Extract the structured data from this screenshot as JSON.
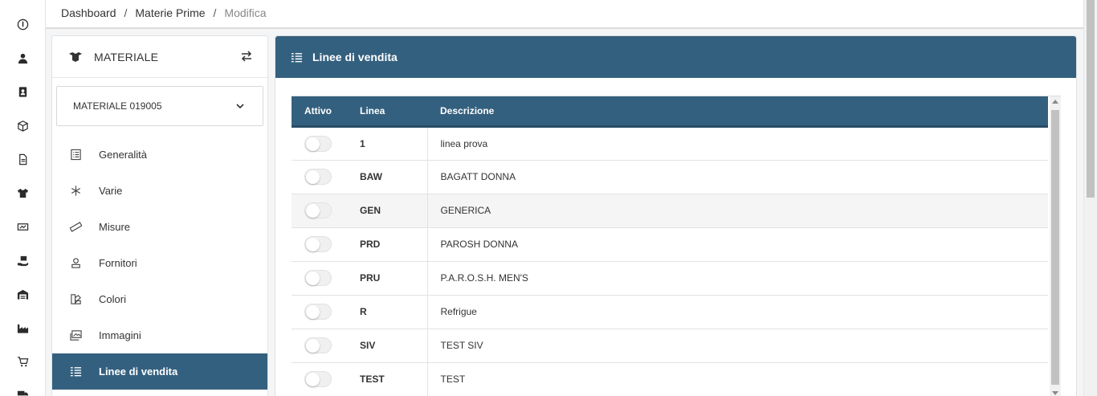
{
  "breadcrumb": {
    "items": [
      "Dashboard",
      "Materie Prime",
      "Modifica"
    ],
    "separator": "/"
  },
  "rail": {
    "icons": [
      "info-icon",
      "user-tie-icon",
      "address-book-icon",
      "box-open-icon",
      "file-icon",
      "tshirt-icon",
      "sign-icon",
      "box-hand-icon",
      "warehouse-icon",
      "industry-icon",
      "cart-icon",
      "truck-icon"
    ]
  },
  "material_card": {
    "title": "MATERIALE",
    "selected_material": "MATERIALE 019005",
    "menu": [
      {
        "label": "Generalità",
        "icon": "list-alt-icon"
      },
      {
        "label": "Varie",
        "icon": "asterisk-icon"
      },
      {
        "label": "Misure",
        "icon": "ruler-icon"
      },
      {
        "label": "Fornitori",
        "icon": "user-stamp-icon"
      },
      {
        "label": "Colori",
        "icon": "palette-icon"
      },
      {
        "label": "Immagini",
        "icon": "images-icon"
      },
      {
        "label": "Linee di vendita",
        "icon": "th-list-icon",
        "active": true
      }
    ]
  },
  "panel": {
    "title": "Linee di vendita",
    "columns": [
      "Attivo",
      "Linea",
      "Descrizione"
    ],
    "rows": [
      {
        "active": false,
        "code": "1",
        "description": "linea prova"
      },
      {
        "active": false,
        "code": "BAW",
        "description": "BAGATT DONNA"
      },
      {
        "active": false,
        "code": "GEN",
        "description": "GENERICA"
      },
      {
        "active": false,
        "code": "PRD",
        "description": "PAROSH DONNA"
      },
      {
        "active": false,
        "code": "PRU",
        "description": "P.A.R.O.S.H. MEN'S"
      },
      {
        "active": false,
        "code": "R",
        "description": "Refrigue"
      },
      {
        "active": false,
        "code": "SIV",
        "description": "TEST SIV"
      },
      {
        "active": false,
        "code": "TEST",
        "description": "TEST"
      }
    ]
  },
  "colors": {
    "primary": "#34607f",
    "background": "#f4f5f6"
  }
}
